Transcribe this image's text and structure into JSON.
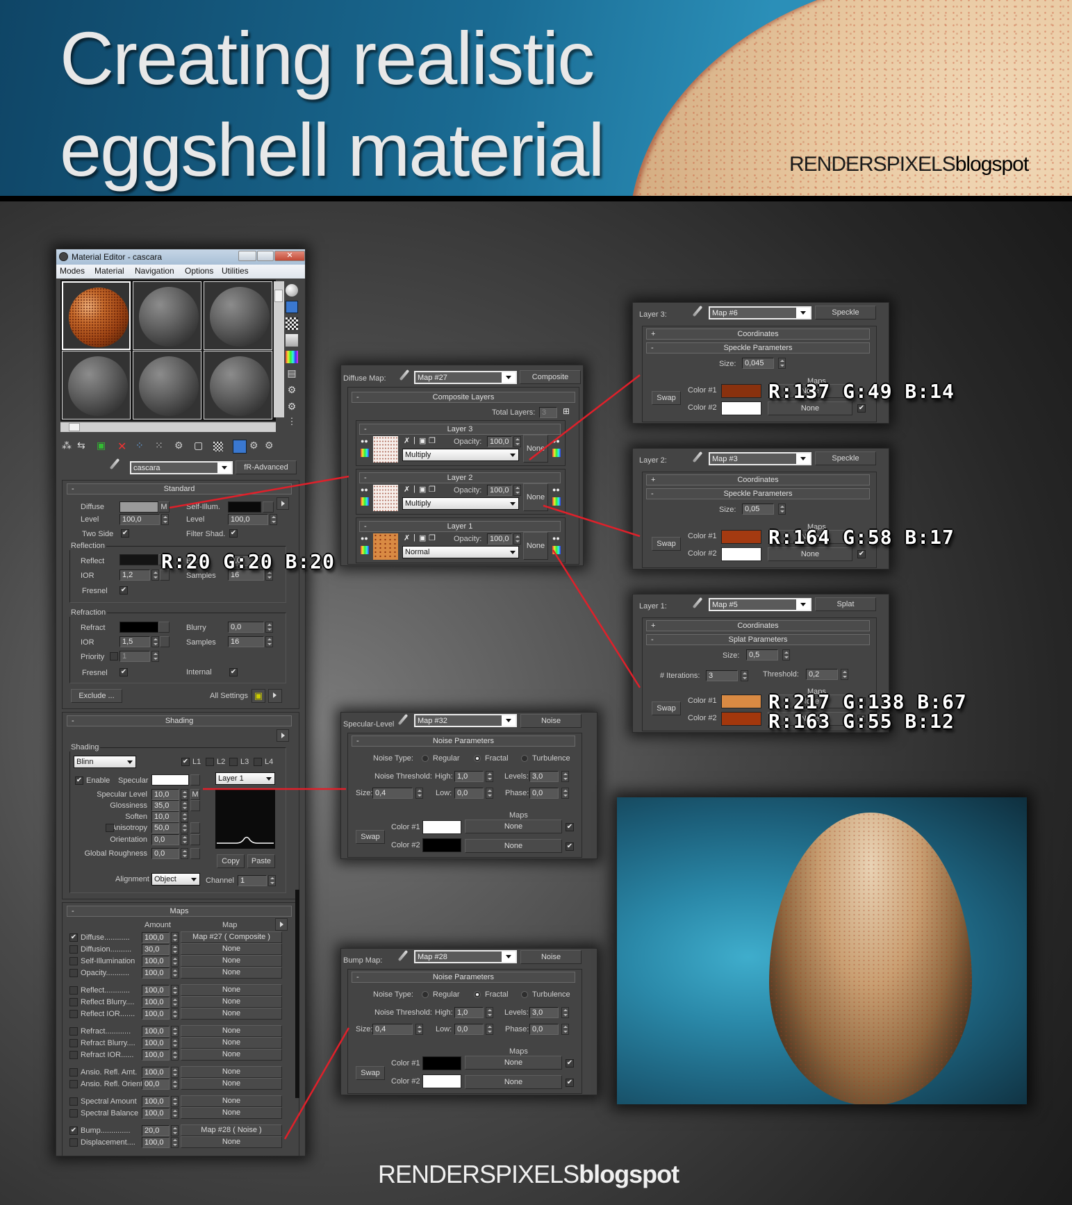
{
  "header": {
    "title_line1": "Creating realistic",
    "title_line2": "eggshell material",
    "brand_light": "RENDERSPIXELS",
    "brand_bold": "blogspot"
  },
  "footer": {
    "brand_light": "RENDERSPIXELS",
    "brand_bold": "blogspot"
  },
  "material_editor": {
    "window_title": "Material Editor - cascara",
    "menu": [
      "Modes",
      "Material",
      "Navigation",
      "Options",
      "Utilities"
    ],
    "material_name": "cascara",
    "material_type": "fR-Advanced",
    "standard": {
      "header": "Standard",
      "diffuse_label": "Diffuse",
      "diffuse_map_button": "M",
      "diffuse_color": "#9a9a9a",
      "self_illum_label": "Self-Illum.",
      "self_illum_color": "#0a0a0a",
      "level_label": "Level",
      "level_value": "100,0",
      "level2_value": "100,0",
      "two_side_label": "Two Side",
      "two_side_checked": true,
      "filter_shad_label": "Filter Shad.",
      "filter_shad_checked": true,
      "reflection": {
        "group_label": "Reflection",
        "reflect_label": "Reflect",
        "reflect_color": "#141414",
        "blurry_label": "Blurry",
        "blurry_value": "0,0",
        "ior_label": "IOR",
        "ior_value": "1,2",
        "samples_label": "Samples",
        "samples_value": "16",
        "fresnel_label": "Fresnel",
        "fresnel_checked": true
      },
      "refraction": {
        "group_label": "Refraction",
        "refract_label": "Refract",
        "refract_color": "#000000",
        "blurry_label": "Blurry",
        "blurry_value": "0,0",
        "ior_label": "IOR",
        "ior_value": "1,5",
        "samples_label": "Samples",
        "samples_value": "16",
        "priority_label": "Priority",
        "priority_value": "1",
        "fresnel_label": "Fresnel",
        "fresnel_checked": true,
        "internal_label": "Internal",
        "internal_checked": true
      },
      "exclude_button": "Exclude ...",
      "all_settings_label": "All Settings"
    },
    "shading": {
      "header": "Shading",
      "group_label": "Shading",
      "shader": "Blinn",
      "layers": [
        {
          "label": "L1",
          "checked": true
        },
        {
          "label": "L2",
          "checked": false
        },
        {
          "label": "L3",
          "checked": false
        },
        {
          "label": "L4",
          "checked": false
        }
      ],
      "enable_label": "Enable",
      "enable_checked": true,
      "specular_label": "Specular",
      "specular_color": "#ffffff",
      "layer_select": "Layer 1",
      "params": [
        {
          "label": "Specular Level",
          "value": "10,0",
          "map": "M"
        },
        {
          "label": "Glossiness",
          "value": "35,0",
          "map": ""
        },
        {
          "label": "Soften",
          "value": "10,0",
          "map": null
        },
        {
          "label": "Anisotropy",
          "value": "50,0",
          "map": ""
        },
        {
          "label": "Orientation",
          "value": "0,0",
          "map": ""
        },
        {
          "label": "Global Roughness",
          "value": "0,0",
          "map": ""
        }
      ],
      "copy_button": "Copy",
      "paste_button": "Paste",
      "alignment_label": "Alignment",
      "alignment_value": "Object",
      "channel_label": "Channel",
      "channel_value": "1"
    },
    "maps": {
      "header": "Maps",
      "amount_header": "Amount",
      "map_header": "Map",
      "rows": [
        {
          "label": "Diffuse............",
          "checked": true,
          "amount": "100,0",
          "map": "Map #27  ( Composite )"
        },
        {
          "label": "Diffusion..........",
          "checked": false,
          "amount": "30,0",
          "map": "None"
        },
        {
          "label": "Self-Illumination",
          "checked": false,
          "amount": "100,0",
          "map": "None"
        },
        {
          "label": "Opacity...........",
          "checked": false,
          "amount": "100,0",
          "map": "None"
        },
        {
          "label": "Reflect............",
          "checked": false,
          "amount": "100,0",
          "map": "None",
          "gap": true
        },
        {
          "label": "Reflect Blurry....",
          "checked": false,
          "amount": "100,0",
          "map": "None"
        },
        {
          "label": "Reflect IOR.......",
          "checked": false,
          "amount": "100,0",
          "map": "None"
        },
        {
          "label": "Refract............",
          "checked": false,
          "amount": "100,0",
          "map": "None",
          "gap": true
        },
        {
          "label": "Refract Blurry....",
          "checked": false,
          "amount": "100,0",
          "map": "None"
        },
        {
          "label": "Refract IOR......",
          "checked": false,
          "amount": "100,0",
          "map": "None"
        },
        {
          "label": "Ansio. Refl. Amt.",
          "checked": false,
          "amount": "100,0",
          "map": "None",
          "gap": true
        },
        {
          "label": "Ansio. Refl. Orient.",
          "checked": false,
          "amount": "00,0",
          "map": "None"
        },
        {
          "label": "Spectral Amount",
          "checked": false,
          "amount": "100,0",
          "map": "None",
          "gap": true
        },
        {
          "label": "Spectral Balance",
          "checked": false,
          "amount": "100,0",
          "map": "None"
        },
        {
          "label": "Bump..............",
          "checked": true,
          "amount": "20,0",
          "map": "Map #28  ( Noise )",
          "gap": true
        },
        {
          "label": "Displacement....",
          "checked": false,
          "amount": "100,0",
          "map": "None"
        }
      ]
    }
  },
  "composite_panel": {
    "slot_label": "Diffuse Map:",
    "map_name": "Map #27",
    "map_type": "Composite",
    "header": "Composite Layers",
    "total_layers_label": "Total Layers:",
    "total_layers_value": "3",
    "layers": [
      {
        "title": "Layer 3",
        "opacity_label": "Opacity:",
        "opacity": "100,0",
        "blend": "Multiply",
        "mask": "None",
        "thumb": "speckle-light"
      },
      {
        "title": "Layer 2",
        "opacity_label": "Opacity:",
        "opacity": "100,0",
        "blend": "Multiply",
        "mask": "None",
        "thumb": "speckle-light"
      },
      {
        "title": "Layer 1",
        "opacity_label": "Opacity:",
        "opacity": "100,0",
        "blend": "Normal",
        "mask": "None",
        "thumb": "splat-orange"
      }
    ]
  },
  "layer_panels": [
    {
      "slot_label": "Layer 3:",
      "map_name": "Map #6",
      "map_type": "Speckle",
      "coords_header": "Coordinates",
      "params_header": "Speckle Parameters",
      "size_label": "Size:",
      "size_value": "0,045",
      "maps_label": "Maps",
      "swap_button": "Swap",
      "color1_label": "Color #1",
      "color1": "#89310e",
      "color1_map": "None",
      "color2_label": "Color #2",
      "color2": "#ffffff",
      "color2_map": "None",
      "rgb_overlay": [
        "R:137  G:49  B:14"
      ]
    },
    {
      "slot_label": "Layer 2:",
      "map_name": "Map #3",
      "map_type": "Speckle",
      "coords_header": "Coordinates",
      "params_header": "Speckle Parameters",
      "size_label": "Size:",
      "size_value": "0,05",
      "maps_label": "Maps",
      "swap_button": "Swap",
      "color1_label": "Color #1",
      "color1": "#a43a11",
      "color1_map": "None",
      "color2_label": "Color #2",
      "color2": "#ffffff",
      "color2_map": "None",
      "rgb_overlay": [
        "R:164  G:58  B:17"
      ]
    },
    {
      "slot_label": "Layer 1:",
      "map_name": "Map #5",
      "map_type": "Splat",
      "coords_header": "Coordinates",
      "params_header": "Splat Parameters",
      "size_label": "Size:",
      "size_value": "0,5",
      "iterations_label": "# Iterations:",
      "iterations_value": "3",
      "threshold_label": "Threshold:",
      "threshold_value": "0,2",
      "maps_label": "Maps",
      "swap_button": "Swap",
      "color1_label": "Color #1",
      "color1": "#d98a43",
      "color1_map": "None",
      "color2_label": "Color #2",
      "color2": "#a3370c",
      "color2_map": "None",
      "rgb_overlay": [
        "R:217  G:138  B:67",
        "R:163  G:55  B:12"
      ]
    }
  ],
  "noise_panels": [
    {
      "slot_label": "Specular-Level",
      "map_name": "Map #32",
      "map_type": "Noise",
      "header": "Noise Parameters",
      "noise_type_label": "Noise Type:",
      "types": [
        "Regular",
        "Fractal",
        "Turbulence"
      ],
      "selected_type": "Fractal",
      "threshold_label": "Noise Threshold:",
      "high_label": "High:",
      "high_value": "1,0",
      "levels_label": "Levels:",
      "levels_value": "3,0",
      "size_label": "Size:",
      "size_value": "0,4",
      "low_label": "Low:",
      "low_value": "0,0",
      "phase_label": "Phase:",
      "phase_value": "0,0",
      "maps_label": "Maps",
      "swap_button": "Swap",
      "color1_label": "Color #1",
      "color1": "#ffffff",
      "color1_map": "None",
      "color2_label": "Color #2",
      "color2": "#000000",
      "color2_map": "None"
    },
    {
      "slot_label": "Bump Map:",
      "map_name": "Map #28",
      "map_type": "Noise",
      "header": "Noise Parameters",
      "noise_type_label": "Noise Type:",
      "types": [
        "Regular",
        "Fractal",
        "Turbulence"
      ],
      "selected_type": "Fractal",
      "threshold_label": "Noise Threshold:",
      "high_label": "High:",
      "high_value": "1,0",
      "levels_label": "Levels:",
      "levels_value": "3,0",
      "size_label": "Size:",
      "size_value": "0,4",
      "low_label": "Low:",
      "low_value": "0,0",
      "phase_label": "Phase:",
      "phase_value": "0,0",
      "maps_label": "Maps",
      "swap_button": "Swap",
      "color1_label": "Color #1",
      "color1": "#000000",
      "color1_map": "None",
      "color2_label": "Color #2",
      "color2": "#ffffff",
      "color2_map": "None"
    }
  ],
  "reflect_rgb_overlay": "R:20  G:20  B:20",
  "accent_colors": {
    "connector_line": "#e0202a",
    "header_blue": "#1a6b93"
  }
}
